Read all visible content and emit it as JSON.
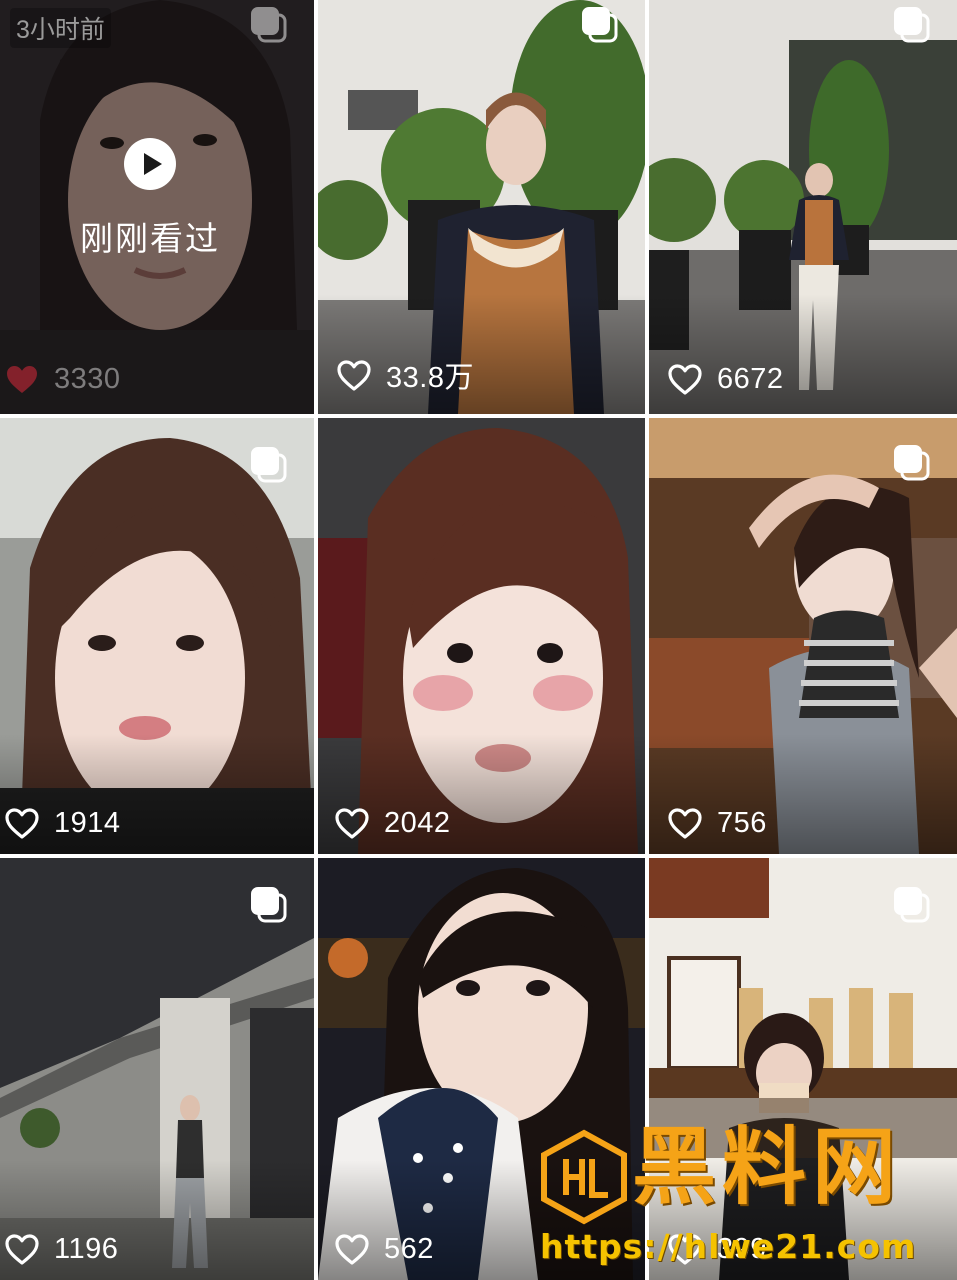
{
  "grid": {
    "posts": [
      {
        "likes": "3330",
        "liked": true,
        "time_label": "3小时前",
        "viewed_label": "刚刚看过",
        "multi_image": true
      },
      {
        "likes": "33.8万",
        "liked": false,
        "multi_image": true
      },
      {
        "likes": "6672",
        "liked": false,
        "multi_image": true
      },
      {
        "likes": "1914",
        "liked": false,
        "multi_image": true
      },
      {
        "likes": "2042",
        "liked": false,
        "multi_image": false
      },
      {
        "likes": "756",
        "liked": false,
        "multi_image": true
      },
      {
        "likes": "1196",
        "liked": false,
        "multi_image": true
      },
      {
        "likes": "562",
        "liked": false,
        "multi_image": false
      },
      {
        "likes": "399",
        "liked": false,
        "multi_image": true
      }
    ]
  },
  "icons": {
    "like": "heart-outline-icon",
    "liked": "heart-filled-icon",
    "multi": "multi-image-icon",
    "play": "play-icon"
  },
  "watermark": {
    "title": "黑料网",
    "url": "https://hlwe21.com"
  },
  "colors": {
    "liked_heart": "#d8293a",
    "watermark_gold": "#f5a317"
  }
}
